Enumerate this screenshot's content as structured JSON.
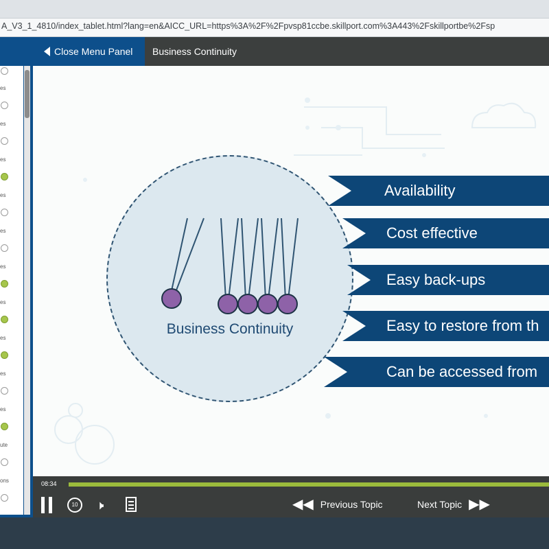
{
  "browser": {
    "url": "A_V3_1_4810/index_tablet.html?lang=en&AICC_URL=https%3A%2F%2Fpvsp81ccbe.skillport.com%3A443%2Fskillportbe%2Fsp"
  },
  "header": {
    "close_menu_label": "Close Menu Panel",
    "course_title": "Business Continuity"
  },
  "menu": {
    "items": [
      {
        "label": "es",
        "completed": false
      },
      {
        "label": "es",
        "completed": false
      },
      {
        "label": "es",
        "completed": true
      },
      {
        "label": "es",
        "completed": false
      },
      {
        "label": "es",
        "completed": false
      },
      {
        "label": "es",
        "completed": true
      },
      {
        "label": "es",
        "completed": true
      },
      {
        "label": "es",
        "completed": true
      },
      {
        "label": "es",
        "completed": false
      },
      {
        "label": "es",
        "completed": true
      },
      {
        "label": "ute",
        "completed": false
      },
      {
        "label": "ons",
        "completed": false
      }
    ]
  },
  "slide": {
    "circle_title": "Business Continuity",
    "bars": [
      {
        "label": "Availability"
      },
      {
        "label": "Cost effective"
      },
      {
        "label": "Easy back-ups"
      },
      {
        "label": "Easy to restore from th"
      },
      {
        "label": "Can be accessed from"
      }
    ],
    "colors": {
      "bar": "#0d4677",
      "ball": "#8e62a8",
      "circle": "#dce8ef"
    }
  },
  "player": {
    "time": "08:34",
    "progress": 1.0,
    "replay_label": "10",
    "prev_label": "Previous Topic",
    "next_label": "Next Topic",
    "accent": "#9bbb3c"
  }
}
